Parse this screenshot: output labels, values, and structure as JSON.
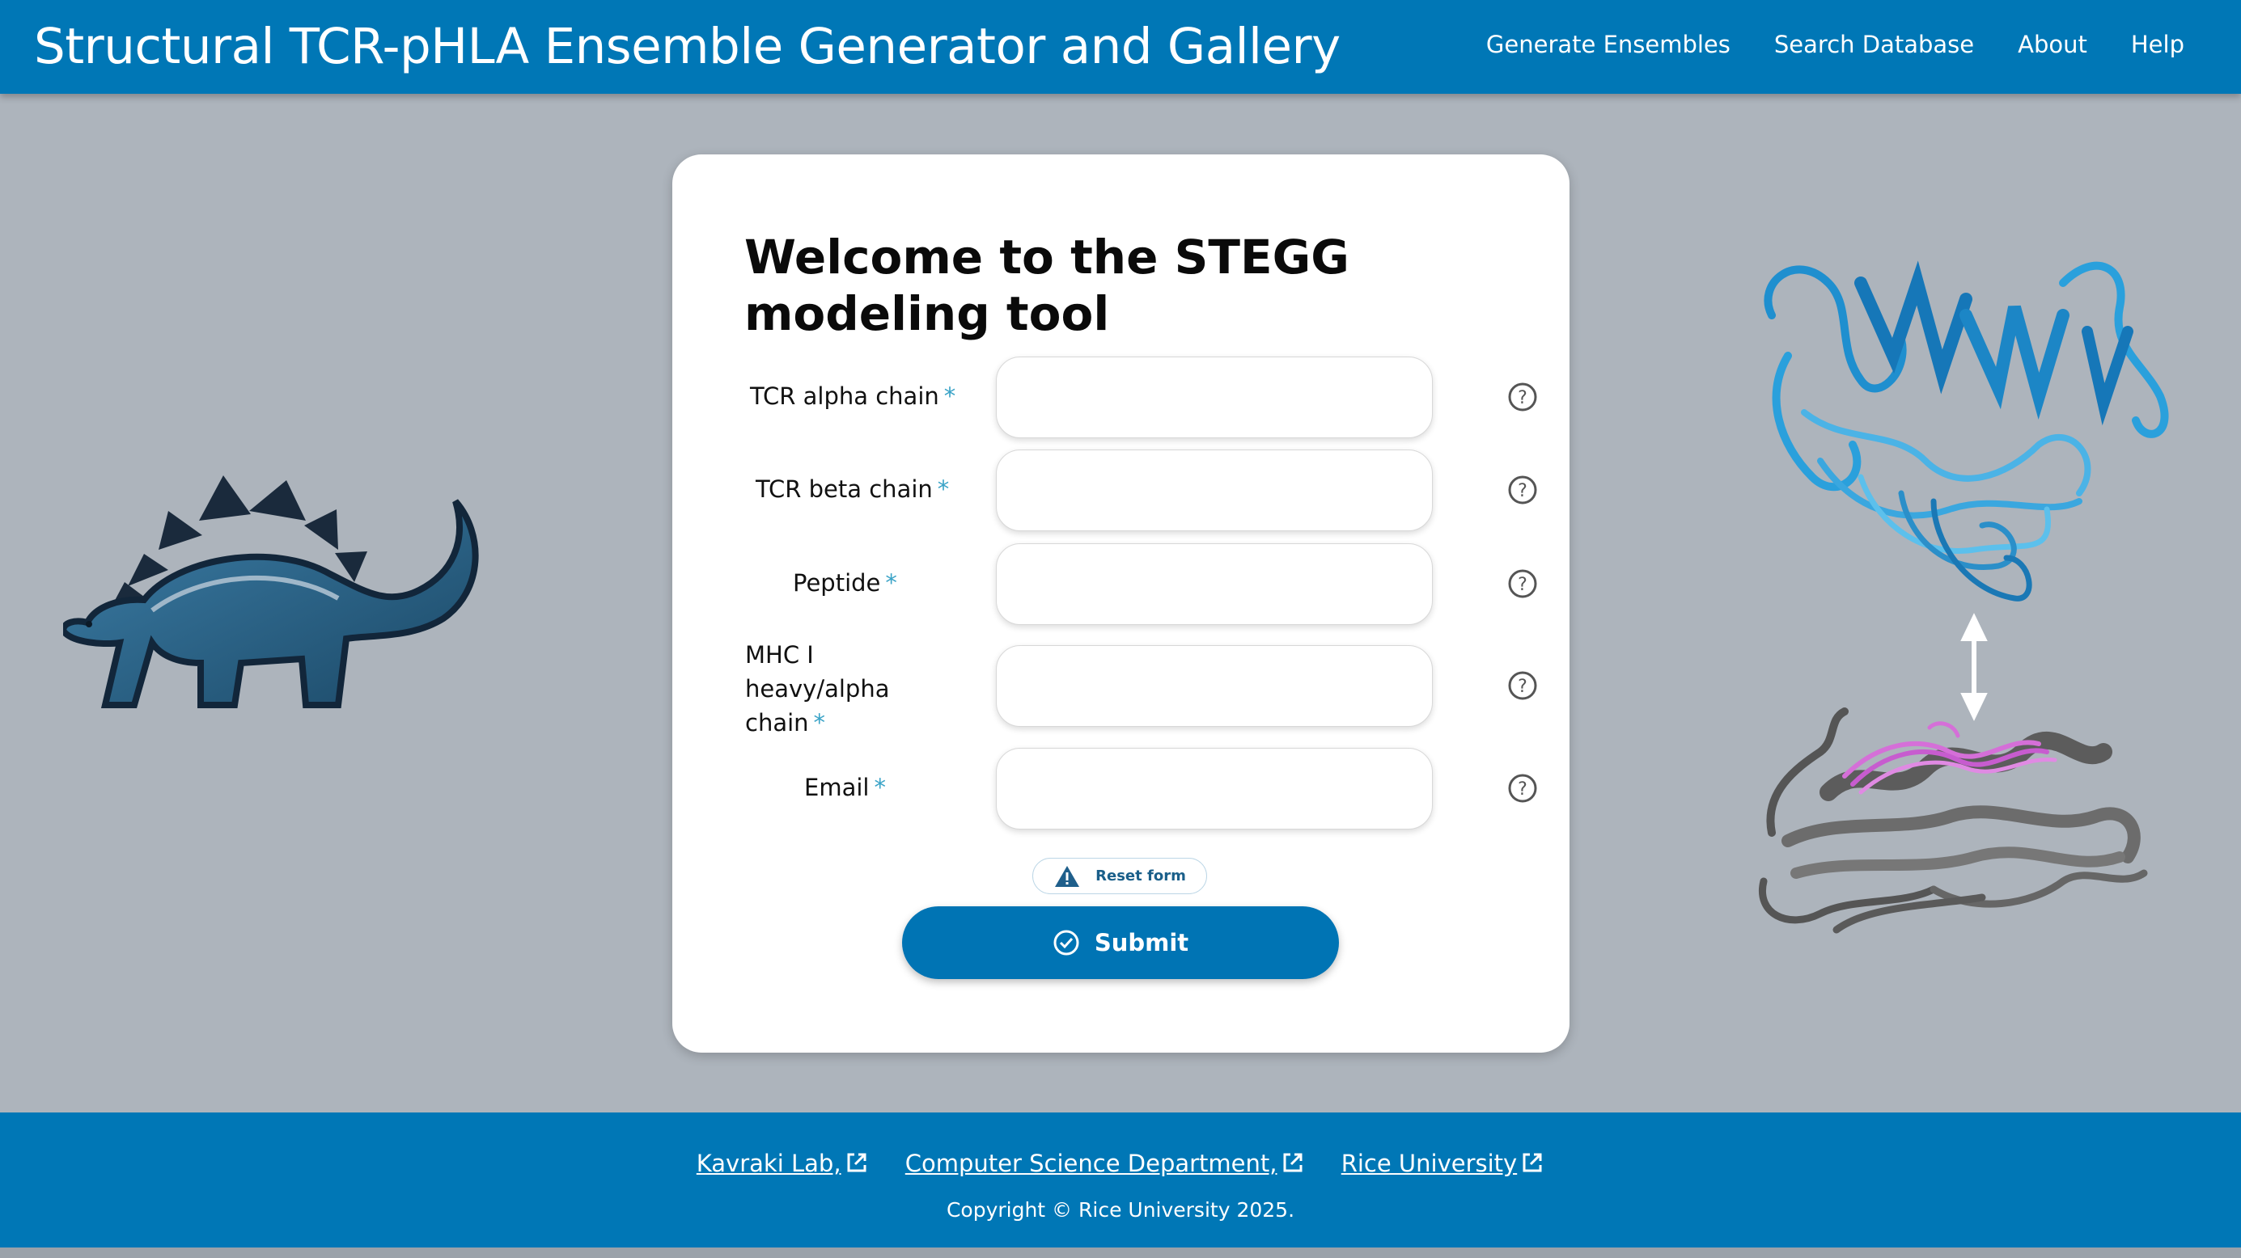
{
  "header": {
    "title": "Structural TCR-pHLA Ensemble Generator and Gallery",
    "nav": [
      "Generate Ensembles",
      "Search Database",
      "About",
      "Help"
    ]
  },
  "form": {
    "heading": "Welcome to the STEGG modeling tool",
    "fields": [
      {
        "label": "TCR alpha chain",
        "value": ""
      },
      {
        "label": "TCR beta chain",
        "value": ""
      },
      {
        "label": "Peptide",
        "value": ""
      },
      {
        "label": "MHC I heavy/alpha chain",
        "value": ""
      },
      {
        "label": "Email",
        "value": ""
      }
    ],
    "required_mark": "*",
    "reset_label": "Reset form",
    "submit_label": "Submit"
  },
  "footer": {
    "links": [
      "Kavraki Lab,",
      "Computer Science Department,",
      "Rice University"
    ],
    "copyright": "Copyright © Rice University 2025."
  },
  "colors": {
    "brand": "#0077b6",
    "background": "#adb4bc",
    "required": "#3aa3c7"
  },
  "icons": [
    "question-circle-icon",
    "warning-triangle-icon",
    "check-circle-icon",
    "external-link-icon"
  ]
}
